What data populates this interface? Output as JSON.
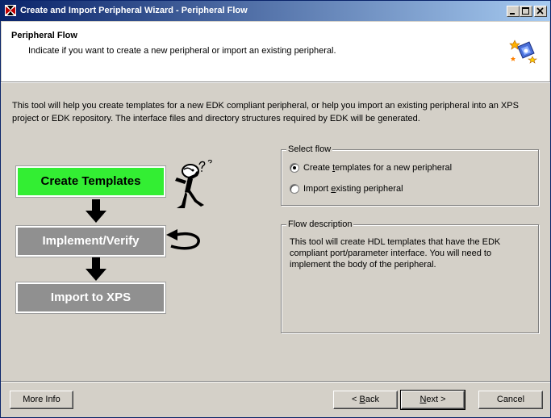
{
  "window": {
    "title": "Create and Import Peripheral Wizard - Peripheral Flow",
    "icon": "xilinx-icon"
  },
  "header": {
    "title": "Peripheral Flow",
    "subtitle": "Indicate if you want to create a new peripheral or import an existing peripheral.",
    "icon": "wizard-puzzle-icon"
  },
  "intro_text": "This tool will help you create templates for a new EDK compliant peripheral, or help you import an existing peripheral into an XPS project or EDK repository. The interface files and directory structures required by EDK will be generated.",
  "flow_diagram": {
    "steps": [
      {
        "label": "Create Templates",
        "active": true
      },
      {
        "label": "Implement/Verify",
        "active": false
      },
      {
        "label": "Import to XPS",
        "active": false
      }
    ],
    "colors": {
      "active": "#33ee33",
      "inactive": "#909090"
    }
  },
  "select_flow": {
    "group_label": "Select flow",
    "options": [
      {
        "pre": "Create ",
        "mnemonic": "t",
        "post": "emplates for a new peripheral",
        "selected": true
      },
      {
        "pre": "Import ",
        "mnemonic": "e",
        "post": "xisting peripheral",
        "selected": false
      }
    ]
  },
  "flow_description": {
    "group_label": "Flow description",
    "text": "This tool will create HDL templates that have the EDK compliant port/parameter interface. You will need to implement the body of the peripheral."
  },
  "buttons": {
    "more_info": "More Info",
    "back_pre": "< ",
    "back_mnemonic": "B",
    "back_post": "ack",
    "next_mnemonic": "N",
    "next_post": "ext >",
    "cancel": "Cancel"
  }
}
